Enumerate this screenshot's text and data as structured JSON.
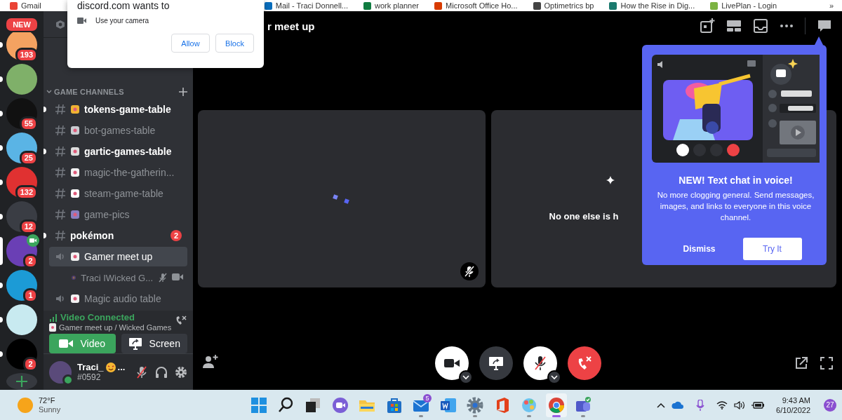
{
  "bookmarks": [
    {
      "label": "Gmail"
    },
    {
      "label": "Mail - Traci Donnell..."
    },
    {
      "label": "work planner"
    },
    {
      "label": "Microsoft Office Ho..."
    },
    {
      "label": "Optimetrics bp"
    },
    {
      "label": "How the Rise in Dig..."
    },
    {
      "label": "LivePlan - Login"
    }
  ],
  "bookmarks_more": "»",
  "permission": {
    "site": "discord.com wants to",
    "request": "Use your camera",
    "allow": "Allow",
    "block": "Block"
  },
  "servers": [
    {
      "kind": "new",
      "label": "NEW"
    },
    {
      "kind": "server",
      "color": "#f4a261",
      "badge": "193",
      "unread": true,
      "selected": false,
      "video": false
    },
    {
      "kind": "server",
      "color": "#7fb069",
      "unread": true,
      "selected": false,
      "video": false
    },
    {
      "kind": "server",
      "color": "#111111",
      "badge": "55",
      "unread": true,
      "selected": false,
      "video": false
    },
    {
      "kind": "server",
      "color": "#5ab4e5",
      "badge": "25",
      "unread": true,
      "selected": false,
      "video": false
    },
    {
      "kind": "server",
      "color": "#e03131",
      "badge": "132",
      "unread": true,
      "selected": false,
      "video": false
    },
    {
      "kind": "server",
      "color": "#3a3d44",
      "badge": "12",
      "unread": true,
      "selected": false,
      "video": false
    },
    {
      "kind": "server",
      "color": "#6a3fb5",
      "badge": "2",
      "unread": false,
      "selected": true,
      "video": true
    },
    {
      "kind": "server",
      "color": "#1c9bd6",
      "badge": "1",
      "unread": true,
      "selected": false,
      "video": false
    },
    {
      "kind": "server",
      "color": "#c8eaf0",
      "unread": true,
      "selected": false,
      "video": false
    },
    {
      "kind": "server",
      "color": "#000000",
      "badge": "2",
      "unread": true,
      "selected": false,
      "video": false
    },
    {
      "kind": "add"
    }
  ],
  "category": "GAME CHANNELS",
  "channels": [
    {
      "kind": "text",
      "name": "tokens-game-table",
      "color": "#f0b232",
      "unread": true,
      "selected": false
    },
    {
      "kind": "text",
      "name": "bot-games-table",
      "color": "#c9ccd1",
      "unread": false,
      "selected": false
    },
    {
      "kind": "text",
      "name": "gartic-games-table",
      "color": "#dddddd",
      "unread": true,
      "selected": false
    },
    {
      "kind": "text",
      "name": "magic-the-gatherin...",
      "color": "#f2f2f2",
      "unread": false,
      "selected": false
    },
    {
      "kind": "text",
      "name": "steam-game-table",
      "color": "#ffffff",
      "unread": false,
      "selected": false
    },
    {
      "kind": "text",
      "name": "game-pics",
      "color": "#8a7fc0",
      "unread": false,
      "selected": false
    },
    {
      "kind": "text",
      "name": "pokémon",
      "badge": "2",
      "unread": true,
      "selected": false
    },
    {
      "kind": "voice",
      "name": "Gamer meet up",
      "color": "#f2f2f2",
      "unread": false,
      "selected": true,
      "members": [
        {
          "name": "Traci IWicked G...",
          "muted": true,
          "video": true
        }
      ]
    },
    {
      "kind": "voice",
      "name": "Magic audio table",
      "color": "#f2f2f2",
      "unread": false,
      "selected": false
    }
  ],
  "voice": {
    "status": "Video Connected",
    "location": "Gamer meet up / Wicked Games",
    "buttons": [
      {
        "kind": "video",
        "label": "Video"
      },
      {
        "kind": "screen",
        "label": "Screen"
      }
    ]
  },
  "user": {
    "name": "Traci_",
    "name_suffix": "...",
    "tag": "#0592",
    "muted": true
  },
  "stage": {
    "title": "r meet up",
    "tiles": [
      {
        "kind": "loading",
        "muted": true
      },
      {
        "kind": "empty",
        "message": "No one else is h"
      }
    ],
    "controls": [
      {
        "kind": "camera",
        "menu": true
      },
      {
        "kind": "screen",
        "menu": false
      },
      {
        "kind": "mic",
        "menu": true
      },
      {
        "kind": "leave",
        "menu": false
      }
    ]
  },
  "tip": {
    "heading": "NEW! Text chat in voice!",
    "body": "No more clogging general. Send messages, images, and links to everyone in this voice channel.",
    "dismiss": "Dismiss",
    "confirm": "Try It"
  },
  "taskbar": {
    "weather": {
      "temperature": "72°F",
      "condition": "Sunny"
    },
    "apps": [
      {
        "kind": "start",
        "running": false,
        "selected": false
      },
      {
        "kind": "search",
        "running": false,
        "selected": false
      },
      {
        "kind": "taskview",
        "running": false,
        "selected": false
      },
      {
        "kind": "chat",
        "running": false,
        "selected": false
      },
      {
        "kind": "explorer",
        "running": false,
        "selected": false
      },
      {
        "kind": "store",
        "running": false,
        "selected": false
      },
      {
        "kind": "mail",
        "badge": "5",
        "running": true,
        "selected": false
      },
      {
        "kind": "word",
        "running": false,
        "selected": false
      },
      {
        "kind": "settings",
        "running": true,
        "selected": false
      },
      {
        "kind": "office",
        "running": false,
        "selected": false
      },
      {
        "kind": "paint",
        "running": true,
        "selected": false
      },
      {
        "kind": "browser",
        "running": true,
        "selected": true
      },
      {
        "kind": "teams",
        "running": true,
        "selected": false
      }
    ],
    "time": "9:43 AM",
    "date": "6/10/2022",
    "notifications": "27"
  }
}
